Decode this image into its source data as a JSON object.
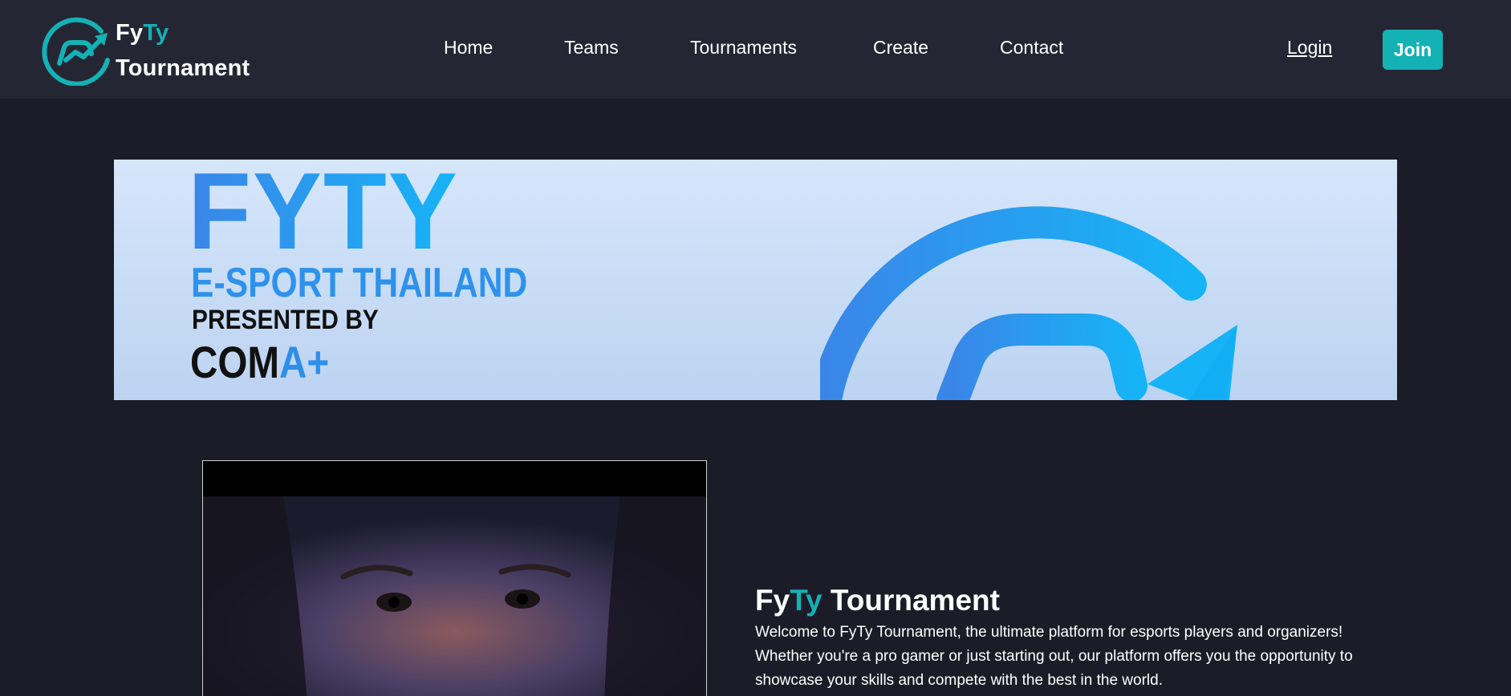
{
  "logo": {
    "part1": "Fy",
    "part2": "Ty",
    "part3": "Tournament"
  },
  "nav": {
    "items": [
      "Home",
      "Teams",
      "Tournaments",
      "Create",
      "Contact"
    ],
    "login": "Login",
    "join": "Join"
  },
  "banner": {
    "title": "FYTY",
    "subtitle": "E-SPORT THAILAND",
    "presented": "PRESENTED BY",
    "brand_main": "COM",
    "brand_accent": "A+"
  },
  "about": {
    "title_part1": "Fy",
    "title_part2": "Ty",
    "title_part3": " Tournament",
    "text": "Welcome to FyTy Tournament, the ultimate platform for esports players and organizers! Whether you're a pro gamer or just starting out, our platform offers you the opportunity to showcase your skills and compete with the best in the world."
  },
  "colors": {
    "accent": "#14b1b5",
    "background": "#1b1c28",
    "navbar": "#252634",
    "banner_blue": "#3a86e8"
  },
  "icons": {
    "logo": "gamepad-arrow-icon"
  }
}
